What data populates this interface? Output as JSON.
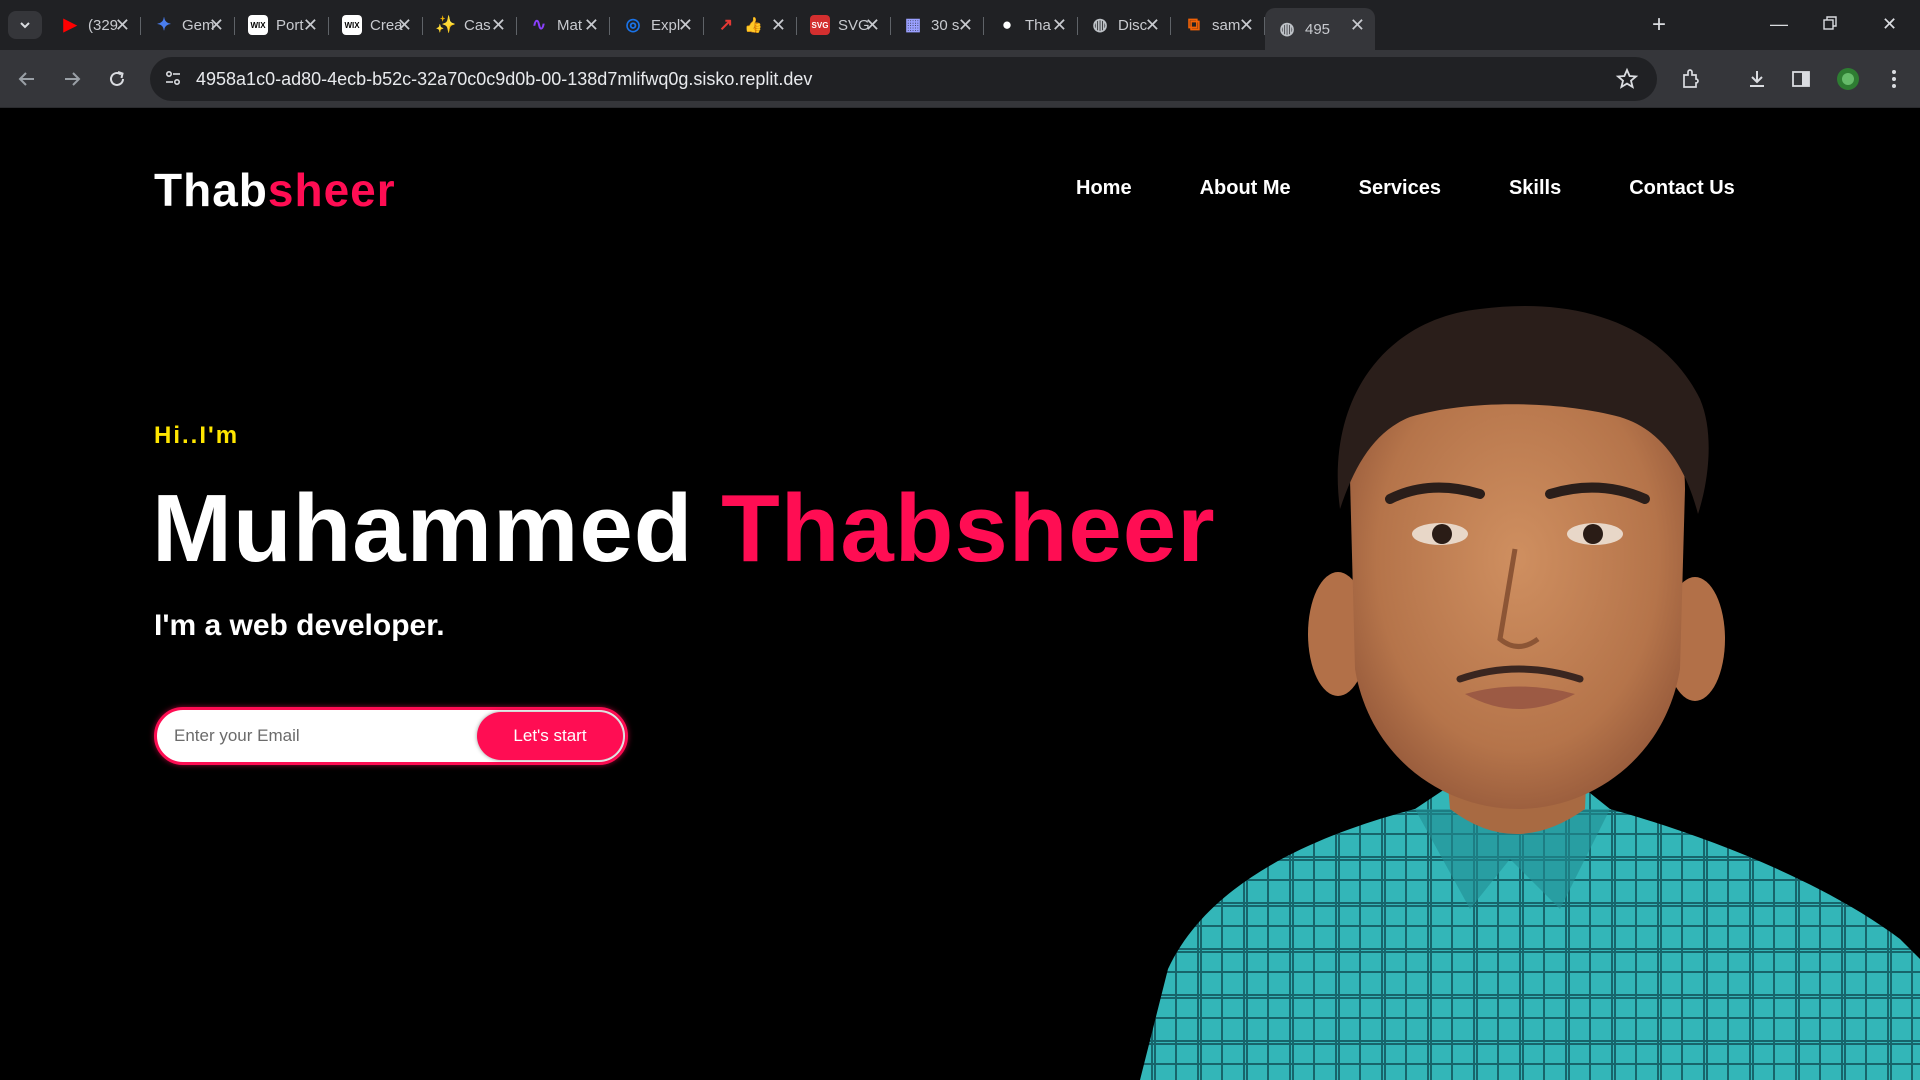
{
  "browser": {
    "tabs": [
      {
        "title": "(329",
        "icon": "youtube-icon",
        "color": "#ff0000",
        "glyph": "▶"
      },
      {
        "title": "Gem",
        "icon": "gemini-icon",
        "color": "#4a7ef0",
        "glyph": "✦"
      },
      {
        "title": "Port",
        "icon": "wix-icon",
        "color": "#ffffff",
        "glyph": "WIX"
      },
      {
        "title": "Crea",
        "icon": "wix-icon",
        "color": "#ffffff",
        "glyph": "WIX"
      },
      {
        "title": "Cas",
        "icon": "sparkle-icon",
        "color": "#f4b400",
        "glyph": "✨"
      },
      {
        "title": "Mat",
        "icon": "chart-app-icon",
        "color": "#8a3ffc",
        "glyph": "∿"
      },
      {
        "title": "Expl",
        "icon": "explore-icon",
        "color": "#1a73e8",
        "glyph": "◎"
      },
      {
        "title": "👍",
        "icon": "arrow-app-icon",
        "color": "#e53935",
        "glyph": "↗"
      },
      {
        "title": "SVG",
        "icon": "svg-png-icon",
        "color": "#d32f2f",
        "glyph": "SVG"
      },
      {
        "title": "30 s",
        "icon": "doc-icon",
        "color": "#9aa0ff",
        "glyph": "▦"
      },
      {
        "title": "Tha",
        "icon": "github-icon",
        "color": "#ffffff",
        "glyph": "●"
      },
      {
        "title": "Disc",
        "icon": "globe-icon",
        "color": "#bdc1c6",
        "glyph": "◍"
      },
      {
        "title": "sam",
        "icon": "replit-icon",
        "color": "#f26207",
        "glyph": "⧉"
      },
      {
        "title": "495",
        "icon": "globe-icon",
        "color": "#bdc1c6",
        "glyph": "◍"
      }
    ],
    "url": "4958a1c0-ad80-4ecb-b52c-32a70c0c9d0b-00-138d7mlifwq0g.sisko.replit.dev"
  },
  "site": {
    "logo_main": "Thab",
    "logo_accent": "sheer",
    "nav": [
      "Home",
      "About Me",
      "Services",
      "Skills",
      "Contact Us"
    ],
    "greeting": "Hi..I'm",
    "name_first": "Muhammed",
    "name_last": "Thabsheer",
    "role": "I'm a web developer.",
    "email_placeholder": "Enter your Email",
    "cta_label": "Let's start"
  },
  "colors": {
    "accent": "#ff0d53",
    "greeting": "#ffe600",
    "background": "#000000",
    "shirt": "#2fb7b8"
  }
}
